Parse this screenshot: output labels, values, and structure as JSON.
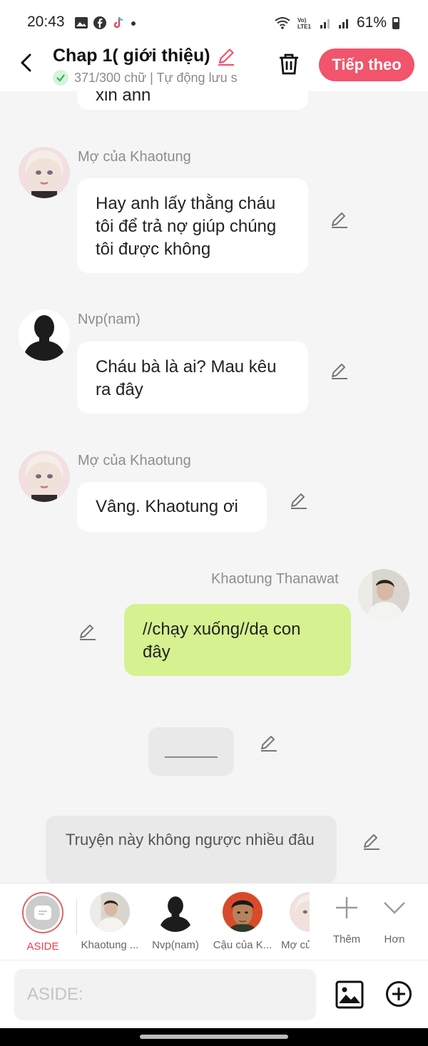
{
  "status_bar": {
    "time": "20:43",
    "battery": "61%"
  },
  "header": {
    "title": "Chap 1( giới thiệu)",
    "subtitle": "371/300 chữ | Tự động lưu s",
    "next_button": "Tiếp theo"
  },
  "messages": [
    {
      "sender": "Mợ của Khaotung",
      "text": "Hay anh lấy thằng cháu tôi để trả nợ giúp chúng tôi được không"
    },
    {
      "sender": "Nvp(nam)",
      "text": "Cháu bà là ai? Mau kêu ra đây"
    },
    {
      "sender": "Mợ của Khaotung",
      "text": "Vâng. Khaotung ơi"
    },
    {
      "sender": "Khaotung Thanawat",
      "text": "//chạy xuống//dạ con đây"
    }
  ],
  "partial_top_text": "xin anh",
  "aside_placeholder_line": "______",
  "aside_text": "Truyện này không ngược nhiều đâu",
  "characters": [
    {
      "label": "ASIDE"
    },
    {
      "label": "Khaotung ..."
    },
    {
      "label": "Nvp(nam)"
    },
    {
      "label": "Cậu của K..."
    },
    {
      "label": "Mợ củ"
    }
  ],
  "actions": {
    "add": "Thêm",
    "more": "Hơn"
  },
  "input": {
    "placeholder": "ASIDE:"
  },
  "colors": {
    "accent": "#f0556b",
    "own_bubble": "#d6f18f",
    "aside_red": "#e8424f"
  }
}
